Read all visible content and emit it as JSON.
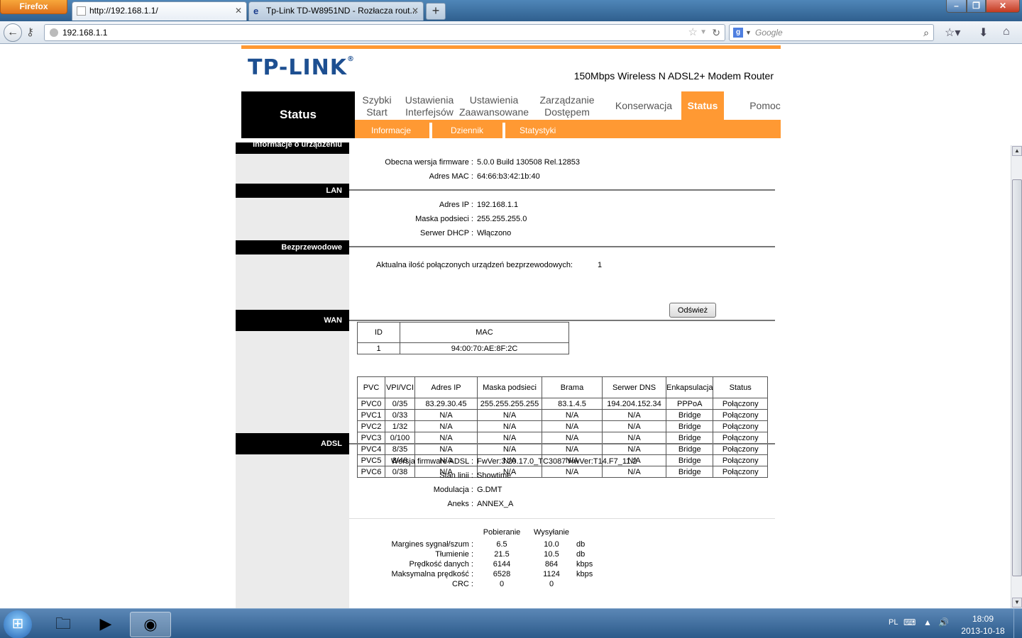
{
  "browser": {
    "app_button": "Firefox",
    "tabs": [
      {
        "title": "http://192.168.1.1/"
      },
      {
        "title": "Tp-Link TD-W8951ND - Rozłacza rout..."
      }
    ],
    "url": "192.168.1.1",
    "search_placeholder": "Google",
    "search_engine_letter": "g"
  },
  "router": {
    "logo": "TP-LINK",
    "logo_reg": "®",
    "model": "150Mbps Wireless N ADSL2+ Modem Router",
    "section_title": "Status",
    "menu": [
      {
        "line1": "Szybki",
        "line2": "Start"
      },
      {
        "line1": "Ustawienia",
        "line2": "Interfejsów"
      },
      {
        "line1": "Ustawienia",
        "line2": "Zaawansowane"
      },
      {
        "line1": "Zarządzanie",
        "line2": "Dostępem"
      },
      {
        "line1": "Konserwacja"
      },
      {
        "line1": "Status"
      },
      {
        "line1": "Pomoc"
      }
    ],
    "submenu": [
      "Informacje",
      "Dziennik",
      "Statystyki"
    ]
  },
  "device_info": {
    "heading": "Informacje o urządzeniu",
    "firmware_label": "Obecna wersja firmware :",
    "firmware_value": "5.0.0 Build 130508 Rel.12853",
    "mac_label": "Adres MAC :",
    "mac_value": "64:66:b3:42:1b:40"
  },
  "lan": {
    "heading": "LAN",
    "ip_label": "Adres IP :",
    "ip_value": "192.168.1.1",
    "mask_label": "Maska podsieci :",
    "mask_value": "255.255.255.0",
    "dhcp_label": "Serwer DHCP :",
    "dhcp_value": "Włączono"
  },
  "wireless": {
    "heading": "Bezprzewodowe",
    "count_label": "Aktualna ilość połączonych urządzeń bezprzewodowych:",
    "count_value": "1",
    "refresh_button": "Odśwież",
    "table_headers": [
      "ID",
      "MAC"
    ],
    "rows": [
      [
        "1",
        "94:00:70:AE:8F:2C"
      ]
    ]
  },
  "wan": {
    "heading": "WAN",
    "headers": [
      "PVC",
      "VPI/VCI",
      "Adres IP",
      "Maska podsieci",
      "Brama",
      "Serwer DNS",
      "Enkapsulacja",
      "Status"
    ],
    "rows": [
      [
        "PVC0",
        "0/35",
        "83.29.30.45",
        "255.255.255.255",
        "83.1.4.5",
        "194.204.152.34",
        "PPPoA",
        "Połączony"
      ],
      [
        "PVC1",
        "0/33",
        "N/A",
        "N/A",
        "N/A",
        "N/A",
        "Bridge",
        "Połączony"
      ],
      [
        "PVC2",
        "1/32",
        "N/A",
        "N/A",
        "N/A",
        "N/A",
        "Bridge",
        "Połączony"
      ],
      [
        "PVC3",
        "0/100",
        "N/A",
        "N/A",
        "N/A",
        "N/A",
        "Bridge",
        "Połączony"
      ],
      [
        "PVC4",
        "8/35",
        "N/A",
        "N/A",
        "N/A",
        "N/A",
        "Bridge",
        "Połączony"
      ],
      [
        "PVC5",
        "8/48",
        "N/A",
        "N/A",
        "N/A",
        "N/A",
        "Bridge",
        "Połączony"
      ],
      [
        "PVC6",
        "0/38",
        "N/A",
        "N/A",
        "N/A",
        "N/A",
        "Bridge",
        "Połączony"
      ]
    ]
  },
  "adsl": {
    "heading": "ADSL",
    "fw_label": "Wersja firmware ADSL :",
    "fw_value": "FwVer:3.20.17.0_TC3087 HwVer:T14.F7_11.2",
    "line_label": "Stan linii :",
    "line_value": "Showtime",
    "mod_label": "Modulacja :",
    "mod_value": "G.DMT",
    "annex_label": "Aneks :",
    "annex_value": "ANNEX_A",
    "col_down": "Pobieranie",
    "col_up": "Wysyłanie",
    "stats": [
      {
        "label": "Margines sygnał/szum :",
        "down": "6.5",
        "up": "10.0",
        "unit": "db"
      },
      {
        "label": "Tłumienie :",
        "down": "21.5",
        "up": "10.5",
        "unit": "db"
      },
      {
        "label": "Prędkość danych :",
        "down": "6144",
        "up": "864",
        "unit": "kbps"
      },
      {
        "label": "Maksymalna prędkość :",
        "down": "6528",
        "up": "1124",
        "unit": "kbps"
      },
      {
        "label": "CRC :",
        "down": "0",
        "up": "0",
        "unit": ""
      }
    ]
  },
  "taskbar": {
    "lang": "PL",
    "time": "18:09",
    "date": "2013-10-18"
  }
}
